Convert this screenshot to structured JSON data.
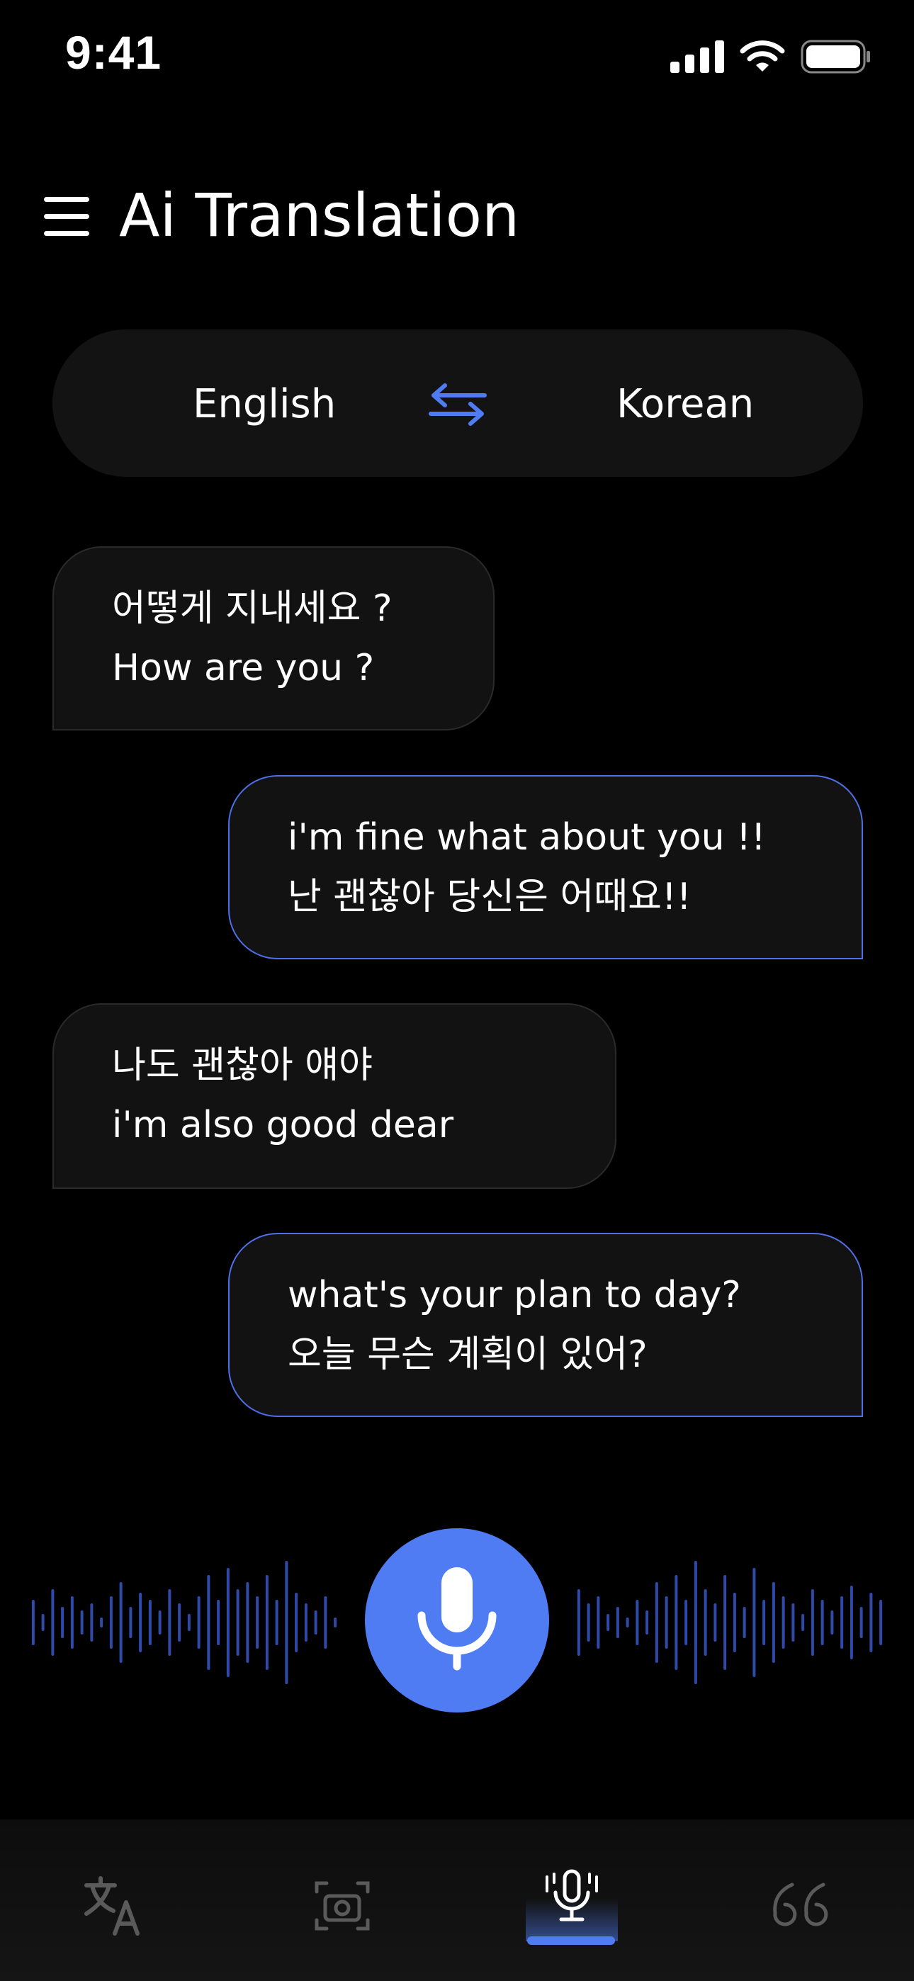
{
  "status_bar": {
    "time": "9:41",
    "icons": [
      "signal-icon",
      "wifi-icon",
      "battery-icon"
    ]
  },
  "header": {
    "title": "Ai Translation",
    "menu_icon": "menu-icon"
  },
  "language_selector": {
    "source": "English",
    "target": "Korean",
    "swap_icon": "swap-arrows-icon"
  },
  "messages": [
    {
      "direction": "incoming",
      "line1": "어떻게 지내세요 ?",
      "line2": "How are you ?"
    },
    {
      "direction": "outgoing",
      "line1": "i'm fine what about you !!",
      "line2": "난 괜찮아 당신은 어때요!!"
    },
    {
      "direction": "incoming",
      "line1": "나도 괜찮아 얘야",
      "line2": "i'm also good dear"
    },
    {
      "direction": "outgoing",
      "line1": "what's your plan to day?",
      "line2": "오늘 무슨 계획이 있어?"
    }
  ],
  "voice": {
    "mic_icon": "microphone-icon",
    "waveform_icon": "waveform-icon"
  },
  "bottom_nav": {
    "items": [
      {
        "icon": "translate-icon",
        "active": false
      },
      {
        "icon": "camera-icon",
        "active": false
      },
      {
        "icon": "voice-mic-icon",
        "active": true
      },
      {
        "icon": "quote-icon",
        "active": false
      }
    ]
  },
  "colors": {
    "background": "#000000",
    "accent": "#4F7CF2",
    "bubble": "#121212",
    "inactive_icon": "#5a5a5a"
  }
}
